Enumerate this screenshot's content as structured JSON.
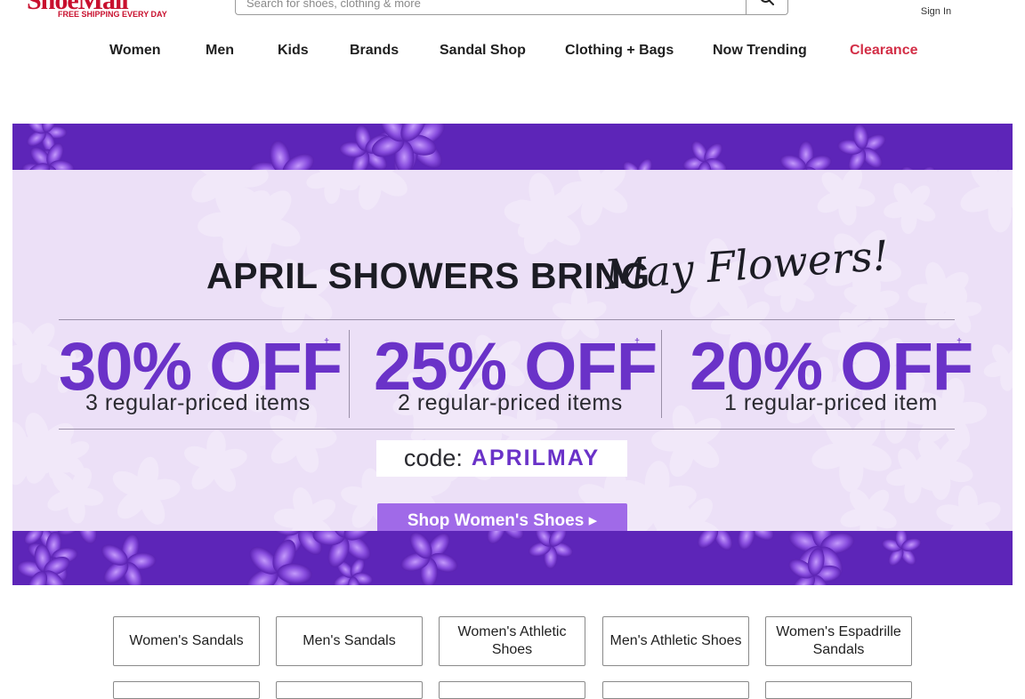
{
  "header": {
    "logo_text": "ShoeMall",
    "logo_tagline": "FREE SHIPPING EVERY DAY",
    "search_placeholder": "Search for shoes, clothing & more",
    "search_icon": "search-icon",
    "account_icon": "user-icon",
    "sign_in_label": "Sign In"
  },
  "nav": {
    "items": [
      {
        "label": "Women"
      },
      {
        "label": "Men"
      },
      {
        "label": "Kids"
      },
      {
        "label": "Brands"
      },
      {
        "label": "Sandal Shop"
      },
      {
        "label": "Clothing + Bags"
      },
      {
        "label": "Now Trending"
      },
      {
        "label": "Clearance"
      }
    ]
  },
  "banner": {
    "headline": "APRIL SHOWERS BRING",
    "script": "May Flowers!",
    "deals": [
      {
        "amount": "30% OFF",
        "detail": "3 regular-priced items"
      },
      {
        "amount": "25% OFF",
        "detail": "2 regular-priced items"
      },
      {
        "amount": "20% OFF",
        "detail": "1 regular-priced item"
      }
    ],
    "dagger": "†",
    "code_label": "code:",
    "code_value": "APRILMAY",
    "cta_label": "Shop Women's Shoes ▸"
  },
  "categories": [
    {
      "label": "Women's Sandals"
    },
    {
      "label": "Men's Sandals"
    },
    {
      "label": "Women's Athletic Shoes"
    },
    {
      "label": "Men's Athletic Shoes"
    },
    {
      "label": "Women's Espadrille Sandals"
    }
  ],
  "colors": {
    "brand_red": "#c8102e",
    "clearance": "#d32f47",
    "deal_purple": "#6a32c8",
    "cta_purple": "#a06ae8",
    "panel": "#ece0f7"
  }
}
